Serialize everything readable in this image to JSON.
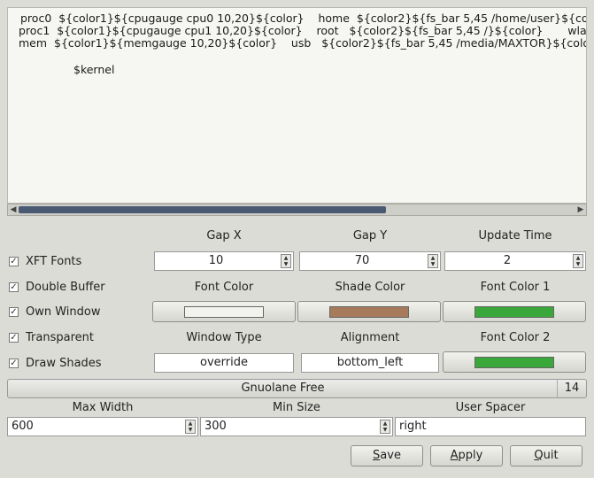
{
  "editor": {
    "lines": [
      "proc0  ${color1}${cpugauge cpu0 10,20}${color}    home  ${color2}${fs_bar 5,45 /home/user}${co",
      "proc1  ${color1}${cpugauge cpu1 10,20}${color}    root   ${color2}${fs_bar 5,45 /}${color}       wla",
      "mem  ${color1}${memgauge 10,20}${color}    usb   ${color2}${fs_bar 5,45 /media/MAXTOR}${colo",
      "$kernel"
    ]
  },
  "headers": {
    "gap_x": "Gap X",
    "gap_y": "Gap Y",
    "update_time": "Update Time",
    "font_color": "Font Color",
    "shade_color": "Shade Color",
    "font_color_1": "Font Color 1",
    "window_type": "Window Type",
    "alignment": "Alignment",
    "font_color_2": "Font Color 2",
    "max_width": "Max Width",
    "min_size": "Min Size",
    "user_spacer": "User Spacer"
  },
  "checks": [
    {
      "label": "XFT Fonts",
      "checked": true
    },
    {
      "label": "Double Buffer",
      "checked": true
    },
    {
      "label": "Own Window",
      "checked": true
    },
    {
      "label": "Transparent",
      "checked": true
    },
    {
      "label": "Draw Shades",
      "checked": true
    }
  ],
  "values": {
    "gap_x": "10",
    "gap_y": "70",
    "update_time": "2",
    "window_type": "override",
    "alignment": "bottom_left",
    "font_name": "Gnuolane Free",
    "font_size": "14",
    "max_width": "600",
    "min_size": "300",
    "user_spacer": "right"
  },
  "colors": {
    "font_color": "#f2f2ee",
    "shade_color": "#a87a5c",
    "font_color_1": "#3aa73a",
    "font_color_2": "#3aa73a"
  },
  "buttons": {
    "save_u": "S",
    "save_rest": "ave",
    "apply_u": "A",
    "apply_rest": "pply",
    "quit_u": "Q",
    "quit_rest": "uit"
  }
}
